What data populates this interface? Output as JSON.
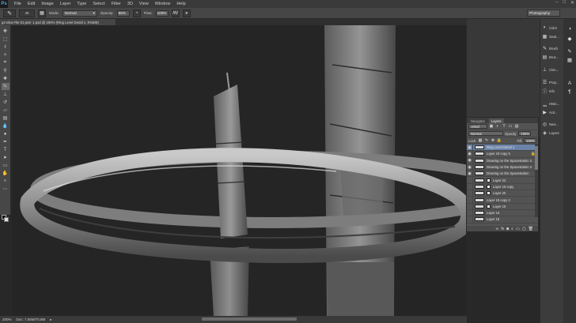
{
  "app": {
    "logo": "Ps"
  },
  "menu": [
    "File",
    "Edit",
    "Image",
    "Layer",
    "Type",
    "Select",
    "Filter",
    "3D",
    "View",
    "Window",
    "Help"
  ],
  "window_controls": {
    "minimize": "–",
    "restore": "□",
    "close": "✕"
  },
  "options": {
    "brush_size": "45",
    "mode_label": "Mode:",
    "mode_value": "Normal",
    "opacity_label": "Opacity:",
    "opacity_value": "86%",
    "flow_label": "Flow:",
    "flow_value": "100%",
    "workspace": "Photography"
  },
  "document_tab": "g4 Idea File 01.psd- 1.psd @ 200% (Ring Level Detail 1, RGB/8)",
  "status": {
    "zoom": "200%",
    "doc": "Doc: 7.56M/70.8M"
  },
  "side_panels": [
    {
      "label": "Color",
      "icon": "color-icon"
    },
    {
      "label": "Swat...",
      "icon": "swatches-icon"
    },
    {
      "label": "Brush",
      "icon": "brush-icon"
    },
    {
      "label": "Brus...",
      "icon": "brush-presets-icon"
    },
    {
      "label": "Clon...",
      "icon": "clone-source-icon"
    },
    {
      "label": "Prop...",
      "icon": "properties-icon"
    },
    {
      "label": "Info",
      "icon": "info-icon"
    },
    {
      "label": "Histo...",
      "icon": "histogram-icon"
    },
    {
      "label": "Acti...",
      "icon": "actions-icon"
    },
    {
      "label": "Navi...",
      "icon": "navigator-icon"
    },
    {
      "label": "Layers",
      "icon": "layers-icon"
    }
  ],
  "layers_panel": {
    "tabs": [
      "Navigator",
      "Layers"
    ],
    "kind": "Kind",
    "blend": "Normal",
    "opacity_label": "Opacity:",
    "opacity": "100%",
    "lock_label": "Lock:",
    "fill_label": "Fill:",
    "fill": "100%",
    "layers": [
      {
        "name": "Ring Level Detail 1",
        "selected": true
      },
      {
        "name": "Layer 19 copy 5",
        "selected": false
      },
      {
        "name": "Drawing on the Spacestation 3",
        "selected": false
      },
      {
        "name": "Drawing on the Spacestation 2",
        "selected": false
      },
      {
        "name": "Drawing on the Spacestation",
        "selected": false
      },
      {
        "name": "Layer 22",
        "selected": false
      },
      {
        "name": "Layer 19 copy",
        "selected": false
      },
      {
        "name": "Layer 20",
        "selected": false
      },
      {
        "name": "Layer 19 copy 2",
        "selected": false
      },
      {
        "name": "Layer 19",
        "selected": false
      },
      {
        "name": "Layer 16",
        "selected": false
      },
      {
        "name": "Layer 18",
        "selected": false
      }
    ]
  },
  "colors": {
    "accent": "#6b83a9",
    "chrome": "#474747",
    "canvas": "#252525"
  }
}
